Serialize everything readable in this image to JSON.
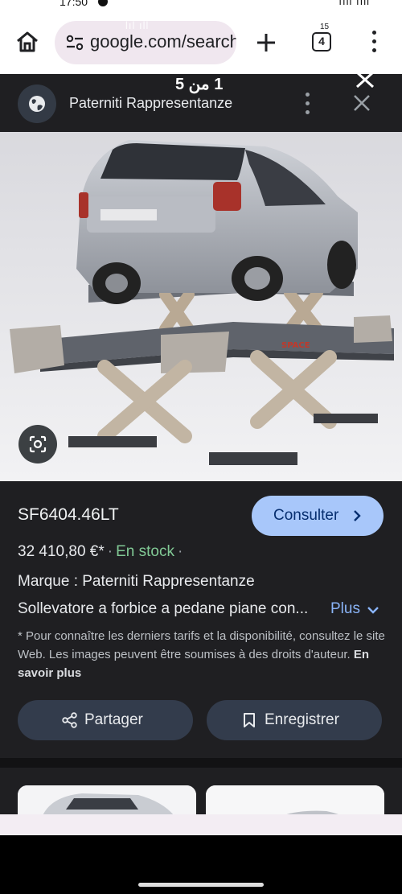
{
  "status": {
    "time": "17:50",
    "right": "ııll ııll"
  },
  "browser": {
    "url": "google.com/search",
    "tab_count": "4",
    "tab_superscript": "15",
    "overlay_ghost": "lıl ıll"
  },
  "viewer": {
    "counter": "1 من 5",
    "source_name": "Paterniti Rappresentanze"
  },
  "product": {
    "title": "SF6404.46LT",
    "consult_label": "Consulter",
    "price": "32 410,80 €*",
    "stock": "En stock",
    "brand": "Marque : Paterniti Rappresentanze",
    "description": "Sollevatore a forbice a pedane piane con...",
    "more_label": "Plus",
    "notice": "* Pour connaître les derniers tarifs et la disponibilité, consultez le site Web. Les images peuvent être soumises à des droits d'auteur.",
    "learn_more": "En savoir plus",
    "share_label": "Partager",
    "save_label": "Enregistrer"
  },
  "colors": {
    "panel": "#1f1f22",
    "accent_button": "#a8c7fa",
    "stock_green": "#81c995",
    "link_blue": "#8ab4f8"
  },
  "icons": [
    "home-icon",
    "site-info-icon",
    "plus-icon",
    "tabs-icon",
    "more-vert-icon",
    "globe-icon",
    "close-icon",
    "lens-icon",
    "chevron-right-icon",
    "chevron-down-icon",
    "share-icon",
    "bookmark-icon"
  ]
}
